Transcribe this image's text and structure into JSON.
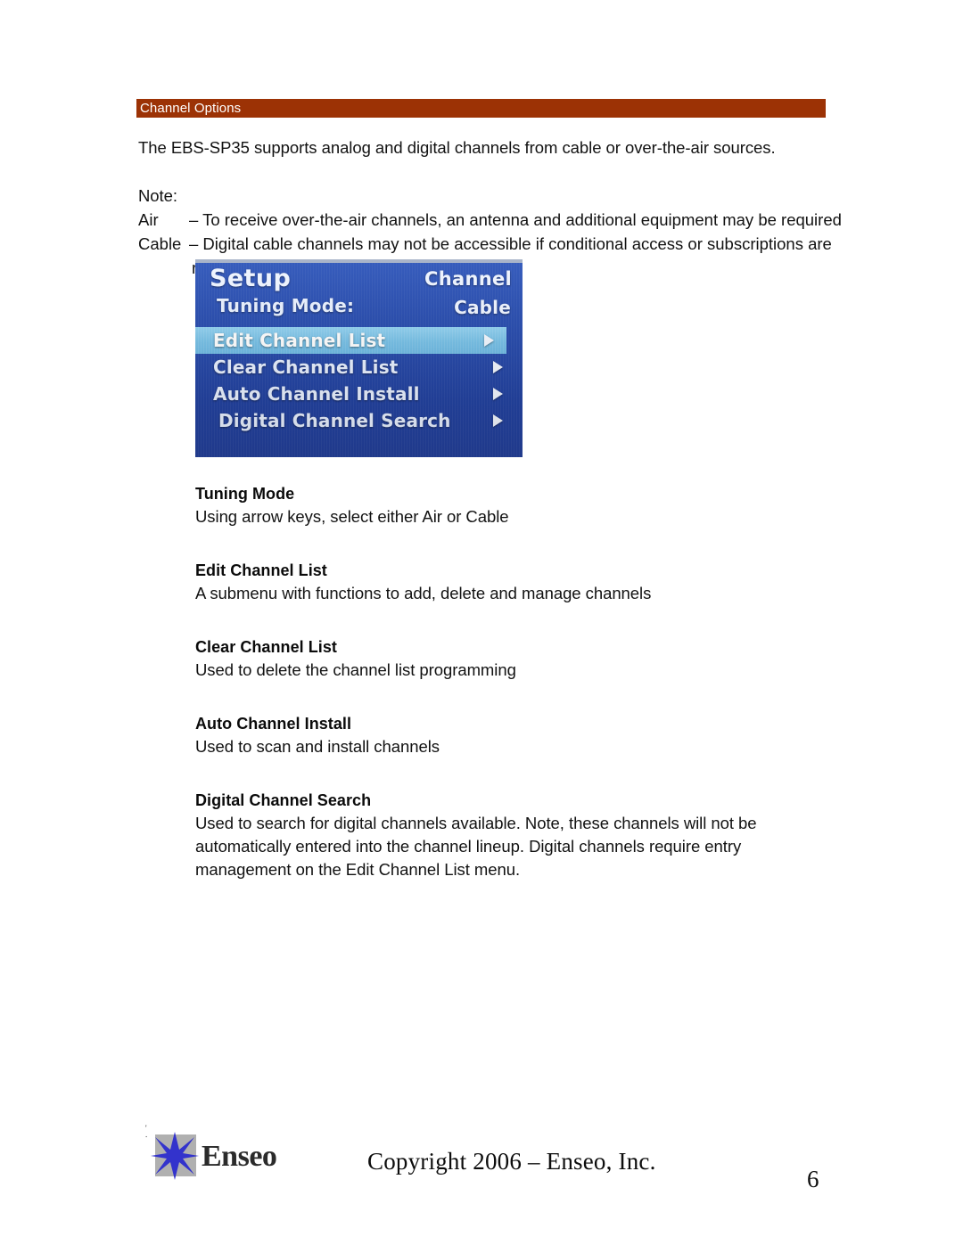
{
  "section": {
    "header_label": "Channel Options",
    "header_color": "#9c3205"
  },
  "intro": {
    "paragraph": "The EBS-SP35 supports analog and digital channels from cable or over-the-air sources.",
    "note_label": "Note:",
    "notes": [
      {
        "key": "Air",
        "value": "– To receive over-the-air channels, an antenna and additional equipment may be required"
      },
      {
        "key": "Cable",
        "value": "– Digital cable channels may not be accessible if conditional access or subscriptions are"
      }
    ],
    "note_continuation": "required"
  },
  "tv_menu": {
    "title": "Setup",
    "title_right": "Channel",
    "setting_label": "Tuning Mode:",
    "setting_value": "Cable",
    "items": [
      {
        "label": "Edit Channel List",
        "arrow": "chevron-right-icon",
        "selected": true
      },
      {
        "label": "Clear Channel List",
        "arrow": "chevron-right-icon",
        "selected": false
      },
      {
        "label": "Auto Channel Install",
        "arrow": "chevron-right-icon",
        "selected": false
      },
      {
        "label": "Digital Channel Search",
        "arrow": "chevron-right-icon",
        "selected": false
      }
    ],
    "highlight_color": "#74bfe6",
    "background_color": "#2449ad"
  },
  "definitions": [
    {
      "term": "Tuning Mode",
      "desc": "Using arrow keys, select either Air or Cable"
    },
    {
      "term": "Edit Channel List",
      "desc": "A submenu with functions to add, delete and manage channels"
    },
    {
      "term": "Clear Channel List",
      "desc": "Used to delete the channel list programming"
    },
    {
      "term": "Auto Channel Install",
      "desc": "Used to scan and install channels"
    },
    {
      "term": "Digital Channel Search",
      "desc": "Used to search for digital channels available. Note, these channels will not be automatically entered into the channel lineup. Digital channels require entry management on the Edit Channel List menu."
    }
  ],
  "footer": {
    "logo_word": "Enseo",
    "logo_mark": "eight-point-star-icon",
    "logo_star_color": "#3333cc",
    "logo_square_color": "#b0b0b0",
    "copyright": "Copyright 2006 – Enseo, Inc.",
    "page_number": "6"
  }
}
